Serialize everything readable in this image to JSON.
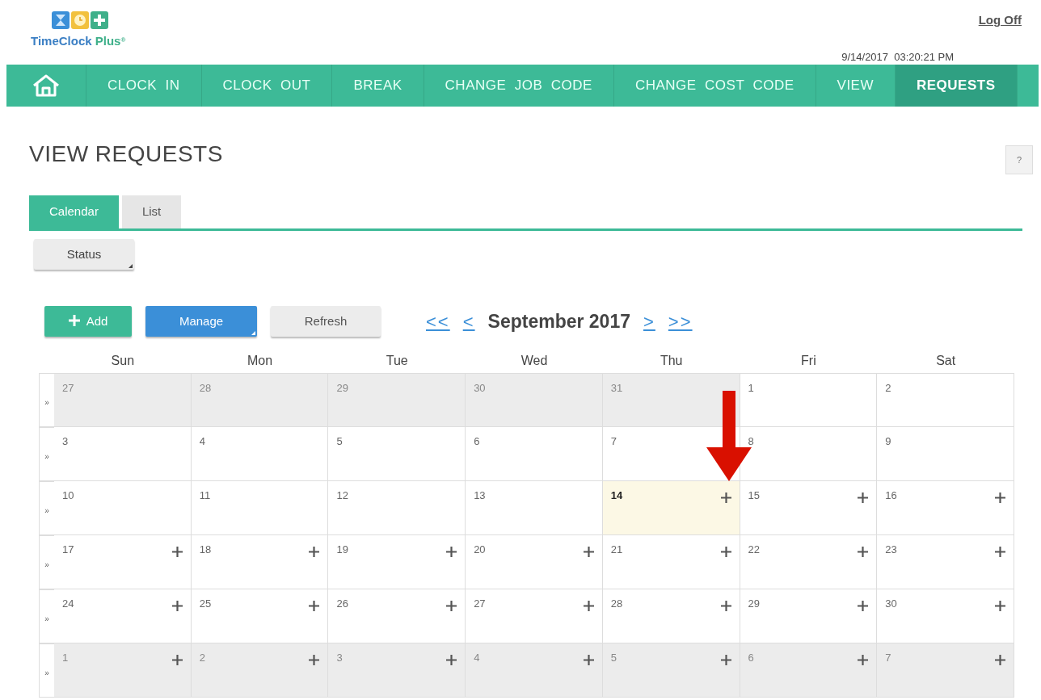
{
  "header": {
    "brand": "TimeClock",
    "brand_suffix": "Plus$^{®}$",
    "logoff": "Log Off",
    "datetime": "9/14/2017  03:20:21 PM"
  },
  "nav": [
    {
      "kind": "home",
      "selected": false
    },
    {
      "kind": "text",
      "label": "CLOCK  IN",
      "selected": false
    },
    {
      "kind": "text",
      "label": "CLOCK  OUT",
      "selected": false
    },
    {
      "kind": "text",
      "label": "BREAK",
      "selected": false
    },
    {
      "kind": "text",
      "label": "CHANGE  JOB  CODE",
      "selected": false
    },
    {
      "kind": "text",
      "label": "CHANGE  COST  CODE",
      "selected": false
    },
    {
      "kind": "text",
      "label": "VIEW",
      "selected": false
    },
    {
      "kind": "text",
      "label": "REQUESTS",
      "selected": true
    }
  ],
  "page": {
    "title": "VIEW REQUESTS",
    "help": "?"
  },
  "tabs": [
    {
      "label": "Calendar",
      "selected": true
    },
    {
      "label": "List",
      "selected": false
    }
  ],
  "filter": {
    "label": "Status",
    "kind": "dropdown"
  },
  "toolbar": [
    {
      "label": "Add",
      "kind": "add"
    },
    {
      "label": "Manage",
      "kind": "primary-dropdown"
    },
    {
      "label": "Refresh",
      "kind": "plain"
    }
  ],
  "month_nav": {
    "first": "<<",
    "prev": "<",
    "month": "September 2017",
    "next": ">",
    "last": ">>"
  },
  "calendar": {
    "weekdays": [
      "Sun",
      "Mon",
      "Tue",
      "Wed",
      "Thu",
      "Fri",
      "Sat"
    ],
    "weeks": [
      {
        "expander": "»",
        "days": [
          {
            "day": "27",
            "other_month": true,
            "today": false,
            "can_add": false
          },
          {
            "day": "28",
            "other_month": true,
            "today": false,
            "can_add": false
          },
          {
            "day": "29",
            "other_month": true,
            "today": false,
            "can_add": false
          },
          {
            "day": "30",
            "other_month": true,
            "today": false,
            "can_add": false
          },
          {
            "day": "31",
            "other_month": true,
            "today": false,
            "can_add": false
          },
          {
            "day": "1",
            "other_month": false,
            "today": false,
            "can_add": false
          },
          {
            "day": "2",
            "other_month": false,
            "today": false,
            "can_add": false
          }
        ]
      },
      {
        "expander": "»",
        "days": [
          {
            "day": "3",
            "other_month": false,
            "today": false,
            "can_add": false
          },
          {
            "day": "4",
            "other_month": false,
            "today": false,
            "can_add": false
          },
          {
            "day": "5",
            "other_month": false,
            "today": false,
            "can_add": false
          },
          {
            "day": "6",
            "other_month": false,
            "today": false,
            "can_add": false
          },
          {
            "day": "7",
            "other_month": false,
            "today": false,
            "can_add": false
          },
          {
            "day": "8",
            "other_month": false,
            "today": false,
            "can_add": false
          },
          {
            "day": "9",
            "other_month": false,
            "today": false,
            "can_add": false
          }
        ]
      },
      {
        "expander": "»",
        "days": [
          {
            "day": "10",
            "other_month": false,
            "today": false,
            "can_add": false
          },
          {
            "day": "11",
            "other_month": false,
            "today": false,
            "can_add": false
          },
          {
            "day": "12",
            "other_month": false,
            "today": false,
            "can_add": false
          },
          {
            "day": "13",
            "other_month": false,
            "today": false,
            "can_add": false
          },
          {
            "day": "14",
            "other_month": false,
            "today": true,
            "can_add": true
          },
          {
            "day": "15",
            "other_month": false,
            "today": false,
            "can_add": true
          },
          {
            "day": "16",
            "other_month": false,
            "today": false,
            "can_add": true
          }
        ]
      },
      {
        "expander": "»",
        "days": [
          {
            "day": "17",
            "other_month": false,
            "today": false,
            "can_add": true
          },
          {
            "day": "18",
            "other_month": false,
            "today": false,
            "can_add": true
          },
          {
            "day": "19",
            "other_month": false,
            "today": false,
            "can_add": true
          },
          {
            "day": "20",
            "other_month": false,
            "today": false,
            "can_add": true
          },
          {
            "day": "21",
            "other_month": false,
            "today": false,
            "can_add": true
          },
          {
            "day": "22",
            "other_month": false,
            "today": false,
            "can_add": true
          },
          {
            "day": "23",
            "other_month": false,
            "today": false,
            "can_add": true
          }
        ]
      },
      {
        "expander": "»",
        "days": [
          {
            "day": "24",
            "other_month": false,
            "today": false,
            "can_add": true
          },
          {
            "day": "25",
            "other_month": false,
            "today": false,
            "can_add": true
          },
          {
            "day": "26",
            "other_month": false,
            "today": false,
            "can_add": true
          },
          {
            "day": "27",
            "other_month": false,
            "today": false,
            "can_add": true
          },
          {
            "day": "28",
            "other_month": false,
            "today": false,
            "can_add": true
          },
          {
            "day": "29",
            "other_month": false,
            "today": false,
            "can_add": true
          },
          {
            "day": "30",
            "other_month": false,
            "today": false,
            "can_add": true
          }
        ]
      },
      {
        "expander": "»",
        "days": [
          {
            "day": "1",
            "other_month": true,
            "today": false,
            "can_add": true
          },
          {
            "day": "2",
            "other_month": true,
            "today": false,
            "can_add": true
          },
          {
            "day": "3",
            "other_month": true,
            "today": false,
            "can_add": true
          },
          {
            "day": "4",
            "other_month": true,
            "today": false,
            "can_add": true
          },
          {
            "day": "5",
            "other_month": true,
            "today": false,
            "can_add": true
          },
          {
            "day": "6",
            "other_month": true,
            "today": false,
            "can_add": true
          },
          {
            "day": "7",
            "other_month": true,
            "today": false,
            "can_add": true
          }
        ]
      }
    ]
  }
}
